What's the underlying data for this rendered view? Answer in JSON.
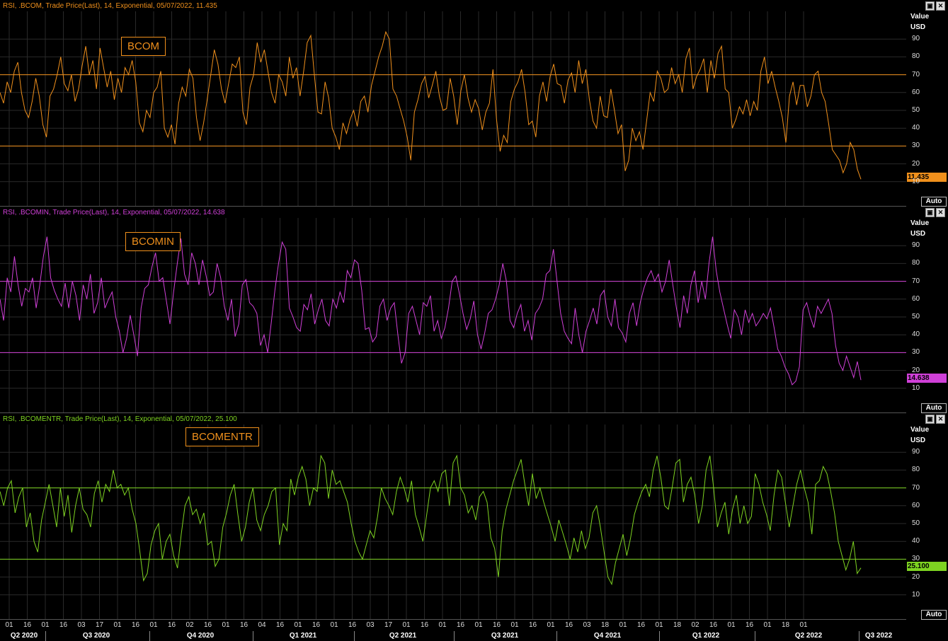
{
  "chart_data": [
    {
      "type": "line",
      "title": "RSI, .BCOM, Trade Price(Last),  14, Exponential, 05/07/2022, 11.435",
      "badge": "BCOM",
      "color": "#f0901c",
      "ylabel": "Value\nUSD",
      "ylim": [
        0,
        100
      ],
      "yticks": [
        10,
        20,
        30,
        40,
        50,
        60,
        70,
        80,
        90
      ],
      "hlines": [
        30,
        70
      ],
      "last_value": "11.435",
      "auto_label": "Auto",
      "series": [
        {
          "values": [
            60,
            54,
            66,
            60,
            72,
            77,
            60,
            50,
            46,
            55,
            68,
            58,
            42,
            35,
            58,
            62,
            70,
            80,
            65,
            61,
            70,
            55,
            62,
            75,
            86,
            70,
            78,
            62,
            85,
            74,
            63,
            72,
            56,
            68,
            60,
            74,
            70,
            78,
            66,
            43,
            38,
            50,
            46,
            60,
            63,
            72,
            40,
            35,
            42,
            31,
            54,
            63,
            58,
            73,
            68,
            46,
            33,
            43,
            56,
            70,
            84,
            76,
            62,
            54,
            65,
            76,
            74,
            80,
            49,
            42,
            63,
            70,
            88,
            77,
            84,
            72,
            60,
            54,
            70,
            66,
            58,
            80,
            68,
            74,
            58,
            72,
            88,
            92,
            70,
            49,
            48,
            66,
            57,
            40,
            35,
            28,
            43,
            37,
            45,
            50,
            41,
            55,
            58,
            49,
            64,
            72,
            80,
            86,
            94,
            90,
            62,
            58,
            51,
            44,
            35,
            22,
            49,
            56,
            65,
            69,
            57,
            64,
            72,
            58,
            50,
            51,
            68,
            58,
            42,
            61,
            70,
            57,
            49,
            56,
            51,
            39,
            49,
            54,
            73,
            45,
            27,
            36,
            32,
            55,
            62,
            66,
            73,
            60,
            42,
            44,
            35,
            58,
            66,
            55,
            69,
            76,
            65,
            64,
            54,
            67,
            71,
            60,
            78,
            65,
            73,
            56,
            44,
            40,
            58,
            47,
            46,
            62,
            50,
            37,
            42,
            16,
            22,
            40,
            33,
            38,
            28,
            44,
            60,
            55,
            72,
            68,
            60,
            62,
            74,
            65,
            70,
            60,
            79,
            85,
            62,
            69,
            73,
            79,
            60,
            78,
            68,
            82,
            86,
            62,
            60,
            40,
            45,
            52,
            48,
            56,
            47,
            55,
            50,
            72,
            80,
            65,
            72,
            63,
            55,
            46,
            32,
            58,
            66,
            53,
            64,
            64,
            52,
            58,
            70,
            72,
            60,
            55,
            42,
            28,
            25,
            22,
            15,
            20,
            32,
            28,
            17,
            11.4
          ]
        }
      ]
    },
    {
      "type": "line",
      "title": "RSI, .BCOMIN, Trade Price(Last),  14, Exponential, 05/07/2022, 14.638",
      "badge": "BCOMIN",
      "color": "#d040d8",
      "ylabel": "Value\nUSD",
      "ylim": [
        0,
        100
      ],
      "yticks": [
        10,
        20,
        30,
        40,
        50,
        60,
        70,
        80,
        90
      ],
      "hlines": [
        30,
        70
      ],
      "last_value": "14.638",
      "auto_label": "Auto",
      "series": [
        {
          "values": [
            60,
            48,
            72,
            64,
            84,
            68,
            56,
            66,
            64,
            72,
            55,
            68,
            84,
            95,
            72,
            65,
            60,
            56,
            69,
            55,
            70,
            62,
            48,
            68,
            60,
            74,
            52,
            58,
            72,
            55,
            60,
            64,
            50,
            42,
            30,
            38,
            51,
            40,
            28,
            55,
            66,
            68,
            78,
            86,
            70,
            72,
            59,
            46,
            64,
            80,
            94,
            74,
            68,
            86,
            80,
            68,
            82,
            73,
            62,
            64,
            80,
            72,
            56,
            48,
            60,
            39,
            46,
            68,
            71,
            58,
            56,
            52,
            34,
            40,
            30,
            47,
            65,
            80,
            92,
            88,
            55,
            50,
            44,
            42,
            57,
            54,
            63,
            46,
            54,
            60,
            48,
            45,
            60,
            55,
            64,
            58,
            76,
            72,
            82,
            80,
            65,
            43,
            44,
            36,
            39,
            56,
            60,
            48,
            55,
            58,
            40,
            24,
            30,
            52,
            56,
            48,
            40,
            58,
            56,
            62,
            42,
            48,
            38,
            44,
            55,
            70,
            73,
            63,
            52,
            43,
            49,
            59,
            40,
            32,
            41,
            52,
            54,
            60,
            68,
            80,
            70,
            48,
            44,
            52,
            57,
            42,
            48,
            37,
            52,
            55,
            60,
            74,
            76,
            88,
            70,
            52,
            42,
            38,
            35,
            55,
            40,
            30,
            42,
            48,
            55,
            46,
            62,
            65,
            50,
            45,
            60,
            44,
            41,
            36,
            52,
            58,
            45,
            58,
            66,
            72,
            76,
            70,
            74,
            64,
            70,
            82,
            68,
            55,
            44,
            62,
            52,
            68,
            76,
            58,
            70,
            60,
            80,
            95,
            76,
            64,
            55,
            46,
            38,
            54,
            50,
            40,
            54,
            47,
            52,
            45,
            48,
            52,
            49,
            55,
            44,
            32,
            28,
            22,
            18,
            12,
            14,
            22,
            54,
            58,
            50,
            44,
            56,
            52,
            56,
            60,
            52,
            34,
            24,
            20,
            28,
            22,
            16,
            25,
            14.6
          ]
        }
      ]
    },
    {
      "type": "line",
      "title": "RSI, .BCOMENTR, Trade Price(Last),  14, Exponential, 05/07/2022, 25.100",
      "badge": "BCOMENTR",
      "color": "#7ed321",
      "ylabel": "Value\nUSD",
      "ylim": [
        0,
        100
      ],
      "yticks": [
        10,
        20,
        30,
        40,
        50,
        60,
        70,
        80,
        90
      ],
      "hlines": [
        30,
        70
      ],
      "last_value": "25.100",
      "auto_label": "Auto",
      "series": [
        {
          "values": [
            68,
            60,
            70,
            74,
            56,
            65,
            70,
            48,
            56,
            40,
            34,
            52,
            62,
            72,
            60,
            48,
            70,
            54,
            66,
            45,
            60,
            70,
            58,
            55,
            48,
            67,
            74,
            62,
            72,
            68,
            80,
            70,
            72,
            66,
            70,
            58,
            50,
            35,
            18,
            22,
            38,
            46,
            50,
            30,
            40,
            44,
            32,
            25,
            44,
            60,
            65,
            55,
            58,
            50,
            56,
            38,
            40,
            26,
            30,
            48,
            56,
            66,
            72,
            55,
            40,
            48,
            62,
            70,
            52,
            46,
            55,
            60,
            68,
            70,
            38,
            50,
            46,
            75,
            66,
            76,
            82,
            75,
            60,
            70,
            68,
            88,
            84,
            64,
            80,
            72,
            74,
            68,
            62,
            50,
            40,
            34,
            30,
            38,
            46,
            42,
            54,
            70,
            64,
            60,
            55,
            68,
            76,
            70,
            62,
            74,
            55,
            48,
            40,
            55,
            70,
            74,
            68,
            78,
            80,
            60,
            84,
            88,
            70,
            66,
            56,
            60,
            52,
            65,
            68,
            62,
            42,
            36,
            20,
            46,
            58,
            66,
            74,
            80,
            86,
            72,
            60,
            78,
            64,
            70,
            62,
            55,
            48,
            40,
            52,
            45,
            38,
            30,
            42,
            34,
            46,
            36,
            42,
            56,
            60,
            48,
            34,
            20,
            16,
            28,
            36,
            44,
            32,
            42,
            55,
            62,
            68,
            72,
            65,
            80,
            88,
            76,
            60,
            58,
            70,
            84,
            86,
            62,
            72,
            76,
            66,
            50,
            60,
            80,
            88,
            70,
            48,
            56,
            62,
            44,
            58,
            66,
            50,
            60,
            50,
            54,
            78,
            72,
            62,
            55,
            46,
            66,
            80,
            76,
            62,
            48,
            60,
            72,
            80,
            70,
            62,
            44,
            72,
            74,
            82,
            78,
            68,
            56,
            40,
            32,
            24,
            30,
            40,
            22,
            25.1
          ]
        }
      ]
    }
  ],
  "y_axis_title": "Value",
  "y_axis_unit": "USD",
  "x_axis": {
    "day_ticks": [
      "01",
      "16",
      "01",
      "16",
      "03",
      "17",
      "01",
      "16",
      "01",
      "16",
      "02",
      "16",
      "01",
      "16",
      "04",
      "16",
      "01",
      "16",
      "01",
      "16",
      "03",
      "17",
      "01",
      "16",
      "01",
      "16",
      "01",
      "16",
      "01",
      "16",
      "01",
      "16",
      "03",
      "18",
      "01",
      "16",
      "01",
      "18",
      "02",
      "16",
      "01",
      "16",
      "01",
      "18",
      "01"
    ],
    "quarters": [
      "Q2 2020",
      "Q3 2020",
      "Q4 2020",
      "Q1 2021",
      "Q2 2021",
      "Q3 2021",
      "Q4 2021",
      "Q1 2022",
      "Q2 2022",
      "Q3 2022"
    ]
  },
  "window_buttons": {
    "restore": "▣",
    "close": "✕"
  }
}
